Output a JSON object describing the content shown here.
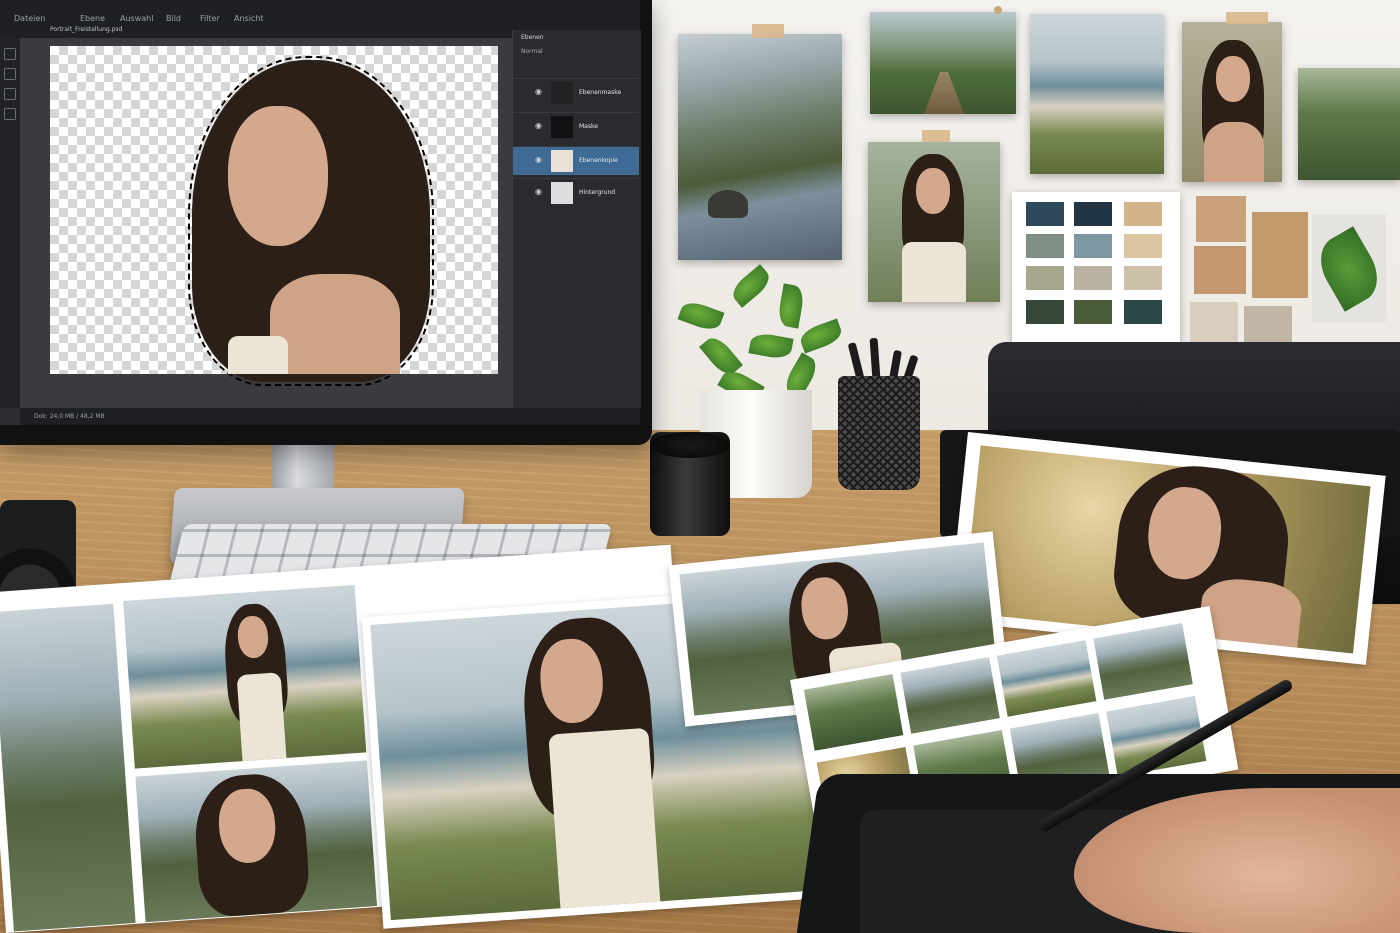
{
  "scene": "photo editing workspace",
  "monitor": {
    "app_tabs": [
      "Dateien",
      "Ebene",
      "Auswahl",
      "Bild",
      "Filter",
      "Ansicht"
    ],
    "document_tab": "Portrait_Freistellung.psd",
    "panel": {
      "title": "Ebenen",
      "mode": "Normal",
      "layers": [
        {
          "name": "Ebenenmaske",
          "selected": false
        },
        {
          "name": "Maske",
          "selected": false
        },
        {
          "name": "Ebenenkopie",
          "selected": true
        },
        {
          "name": "Hintergrund",
          "selected": false
        }
      ]
    },
    "status_text": "Dok: 24,0 MB / 48,2 MB"
  },
  "colors": {
    "selected_layer": "#3f6a94",
    "desk": "#c59c66",
    "wall": "#efece7"
  },
  "palette_swatches": [
    "#2f4a5c",
    "#223544",
    "#d4b48a",
    "#7f8f86",
    "#7e98a3",
    "#dcc6a2",
    "#a9a690",
    "#b9b2a0",
    "#cbbfa8",
    "#35483a",
    "#4a5e3c",
    "#2c4747"
  ],
  "fabric_swatches": [
    "#c9a27b",
    "#c4986f",
    "#c29a6b",
    "#d8ccbd",
    "#c2b6a6"
  ],
  "icons": [
    "eye-icon",
    "layer-lock-icon",
    "brush-icon",
    "lasso-icon"
  ]
}
